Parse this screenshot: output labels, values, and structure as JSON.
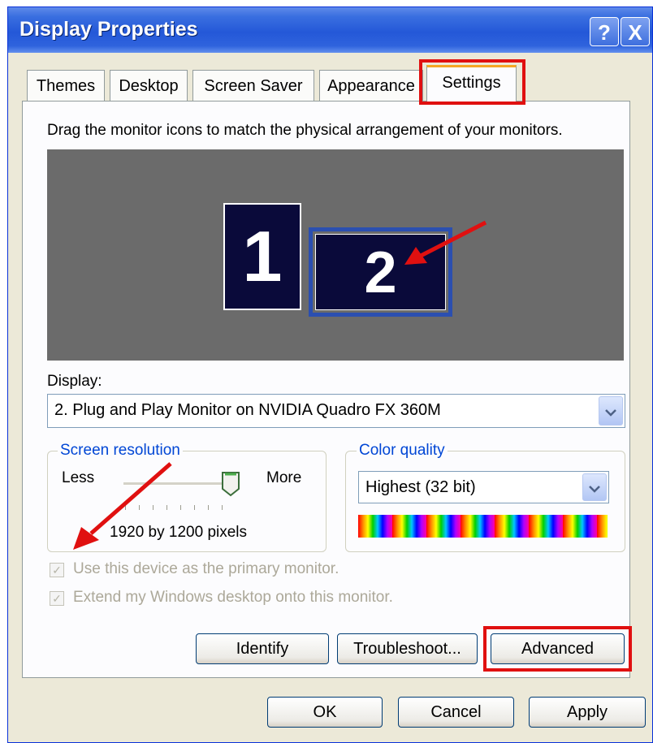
{
  "window": {
    "title": "Display Properties",
    "help_label": "?",
    "close_label": "X"
  },
  "tabs": [
    {
      "label": "Themes"
    },
    {
      "label": "Desktop"
    },
    {
      "label": "Screen Saver"
    },
    {
      "label": "Appearance"
    },
    {
      "label": "Settings",
      "selected": true
    }
  ],
  "instructions": "Drag the monitor icons to match the physical arrangement of your monitors.",
  "monitors": [
    {
      "label": "1"
    },
    {
      "label": "2",
      "selected": true
    }
  ],
  "display": {
    "label": "Display:",
    "value": "2. Plug and Play Monitor on NVIDIA Quadro FX 360M"
  },
  "screen_resolution": {
    "legend": "Screen resolution",
    "less_label": "Less",
    "more_label": "More",
    "value_text": "1920 by 1200 pixels",
    "slider_level": 1.0
  },
  "color_quality": {
    "legend": "Color quality",
    "value": "Highest (32 bit)"
  },
  "checkboxes": [
    {
      "label": "Use this device as the primary monitor.",
      "checked": true,
      "disabled": true
    },
    {
      "label": "Extend my Windows desktop onto this monitor.",
      "checked": true,
      "disabled": true
    }
  ],
  "buttons": {
    "identify": "Identify",
    "troubleshoot": "Troubleshoot...",
    "advanced": "Advanced",
    "ok": "OK",
    "cancel": "Cancel",
    "apply": "Apply"
  },
  "colors": {
    "highlight": "#e01010",
    "titlebar": "#2458d8",
    "monitor_fill": "#0a0a3a",
    "preview_bg": "#6b6b6b"
  }
}
